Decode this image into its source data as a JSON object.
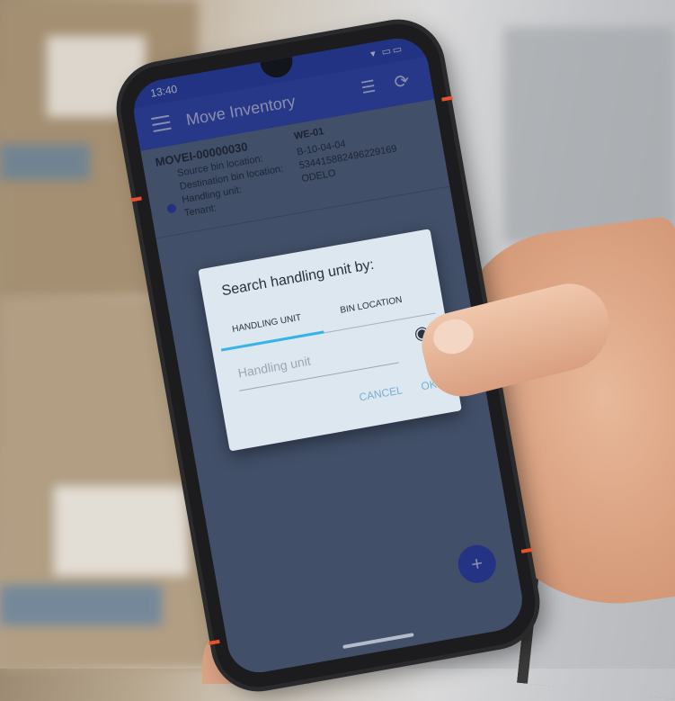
{
  "status_bar": {
    "time": "13:40",
    "icons": "▾ ▭▭"
  },
  "app_bar": {
    "title": "Move Inventory",
    "menu_icon": "menu-icon",
    "filter_icon": "filter-icon",
    "refresh_icon": "refresh-icon"
  },
  "task": {
    "id": "MOVEI-00000030",
    "warehouse": "WE-01",
    "rows": [
      {
        "label": "Source bin location:",
        "value": "B-10-04-04"
      },
      {
        "label": "Destination bin location:",
        "value": "534415882496229169"
      },
      {
        "label": "Handling unit:",
        "value": "ODELO"
      },
      {
        "label": "Tenant:",
        "value": ""
      }
    ]
  },
  "dialog": {
    "title": "Search handling unit by:",
    "tabs": [
      "HANDLING UNIT",
      "BIN LOCATION"
    ],
    "active_tab": 0,
    "input_placeholder": "Handling unit",
    "input_value": "",
    "cancel_label": "CANCEL",
    "ok_label": "OK",
    "accent_color": "#35b4ea"
  },
  "fab_icon": "add-icon",
  "colors": {
    "primary": "#3447b8",
    "accent_orange": "#e8512b"
  }
}
